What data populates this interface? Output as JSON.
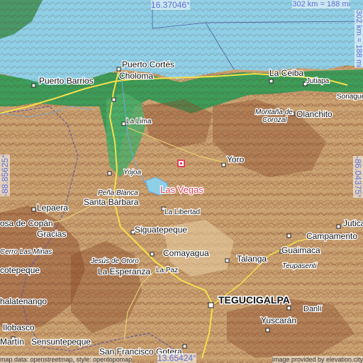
{
  "map": {
    "focus": {
      "name": "Las Vegas",
      "color": "#e0405a"
    },
    "coords": {
      "top": "16.37046°",
      "bottom": "13.65424°",
      "left": "-88.85625°",
      "right": "-86.04375°"
    },
    "scale": {
      "horizontal": "302 km = 188 mi",
      "vertical": "302 km = 188 mi"
    },
    "attribution": {
      "left": "map data: openstreetmap, style: opentopomap",
      "right": "image provided by elevation.city"
    },
    "capital": "TEGUCIGALPA",
    "places": [
      {
        "name": "Puerto Cortés"
      },
      {
        "name": "Puerto Barrios"
      },
      {
        "name": "Choloma"
      },
      {
        "name": "La Ceiba"
      },
      {
        "name": "Jutiapa"
      },
      {
        "name": "Sonague"
      },
      {
        "name": "La Lima"
      },
      {
        "name": "Olanchito"
      },
      {
        "name": "Montaña de Corozal"
      },
      {
        "name": "Yoro"
      },
      {
        "name": "Yojoa"
      },
      {
        "name": "Peña Blanca"
      },
      {
        "name": "Santa Bárbara"
      },
      {
        "name": "La Libertad"
      },
      {
        "name": "Lepaera"
      },
      {
        "name": "osa de Copán"
      },
      {
        "name": "Gracias"
      },
      {
        "name": "Siguatepeque"
      },
      {
        "name": "Campamento"
      },
      {
        "name": "Jutica"
      },
      {
        "name": "Cerro Las Minas"
      },
      {
        "name": "Comayagua"
      },
      {
        "name": "Talanga"
      },
      {
        "name": "Guaimaca"
      },
      {
        "name": "Jesús de Otoro"
      },
      {
        "name": "cotepeque"
      },
      {
        "name": "La Esperanza"
      },
      {
        "name": "La Paz"
      },
      {
        "name": "Teupasenti"
      },
      {
        "name": "halatenango"
      },
      {
        "name": "Danlí"
      },
      {
        "name": "Yuscarán"
      },
      {
        "name": "Ilobasco"
      },
      {
        "name": "Martín"
      },
      {
        "name": "Sensuntepeque"
      },
      {
        "name": "San Francisco Gotera"
      }
    ],
    "colors": {
      "sea": "#8ecfe6",
      "lowland": "#2f9a55",
      "hills": "#c9a070",
      "mountains": "#8b4a2c",
      "roads": "#f3e04a"
    }
  }
}
